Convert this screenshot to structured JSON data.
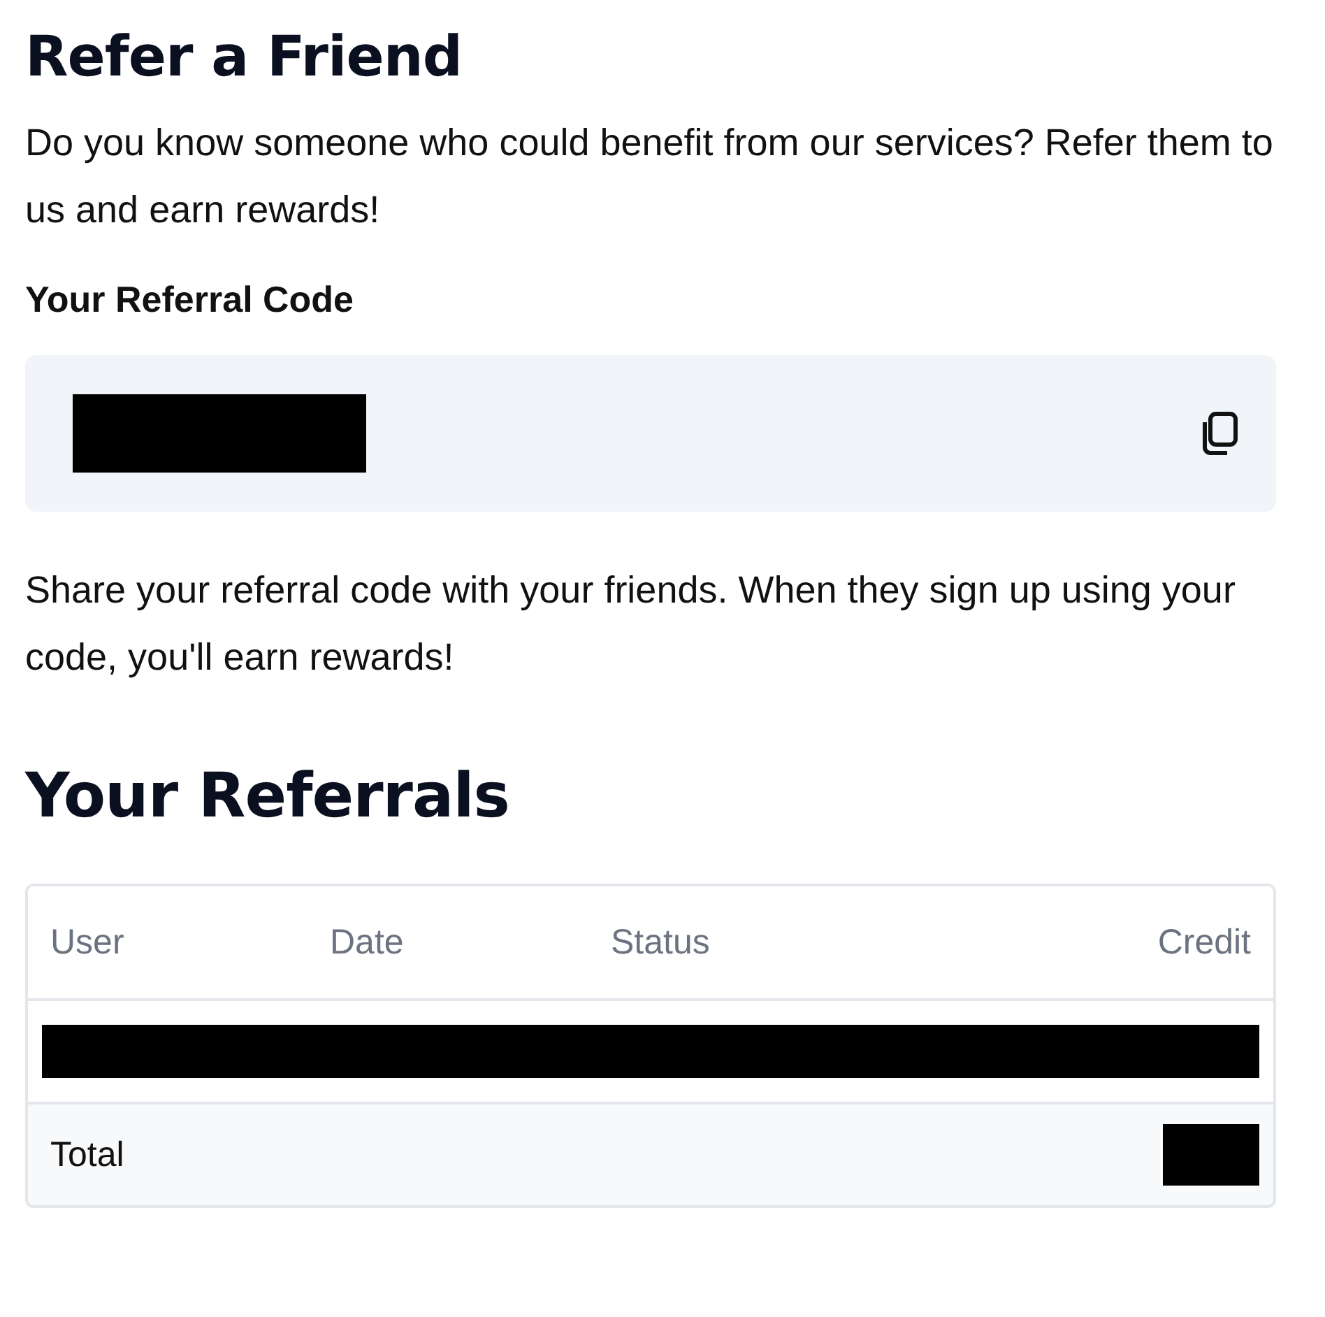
{
  "title": "Refer a Friend",
  "intro": "Do you know someone who could benefit from our services? Refer them to us and earn rewards!",
  "code_label": "Your Referral Code",
  "code": {
    "kind": "redacted"
  },
  "share_note": "Share your referral code with your friends. When they sign up using your code, you'll earn rewards!",
  "referrals_title": "Your Referrals",
  "table": {
    "columns": [
      "User",
      "Date",
      "Status",
      "Credit"
    ],
    "rows": [
      {
        "kind": "redacted"
      }
    ],
    "total": {
      "label": "Total",
      "kind": "redacted"
    }
  }
}
